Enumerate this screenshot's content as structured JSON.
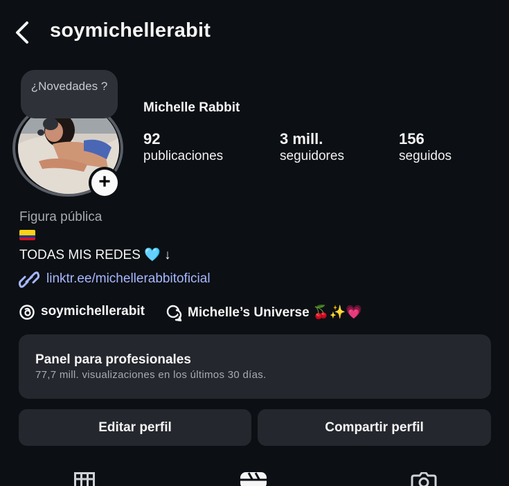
{
  "header": {
    "username": "soymichellerabit",
    "back_icon": "chevron-left-icon"
  },
  "note": {
    "text": "¿Novedades ?"
  },
  "profile": {
    "name": "Michelle Rabbit",
    "stats": [
      {
        "value": "92",
        "label": "publicaciones"
      },
      {
        "value": "3 mill.",
        "label": "seguidores"
      },
      {
        "value": "156",
        "label": "seguidos"
      }
    ],
    "category": "Figura pública",
    "flag": "colombia-flag",
    "bio": "TODAS MIS REDES 🩵 ↓",
    "link": "linktr.ee/michellerabbitoficial",
    "threads_handle": "soymichellerabit",
    "channel_name": "Michelle’s Universe 🍒✨💗"
  },
  "panel": {
    "title": "Panel para profesionales",
    "subtitle": "77,7 mill. visualizaciones en los últimos 30 días."
  },
  "buttons": {
    "edit": "Editar perfil",
    "share": "Compartir perfil"
  },
  "tabs": [
    "grid-icon",
    "reels-icon",
    "tagged-icon"
  ],
  "colors": {
    "background": "#0c1014",
    "surface": "#24272d",
    "link": "#a6b7ff",
    "muted": "#a8aab0"
  }
}
